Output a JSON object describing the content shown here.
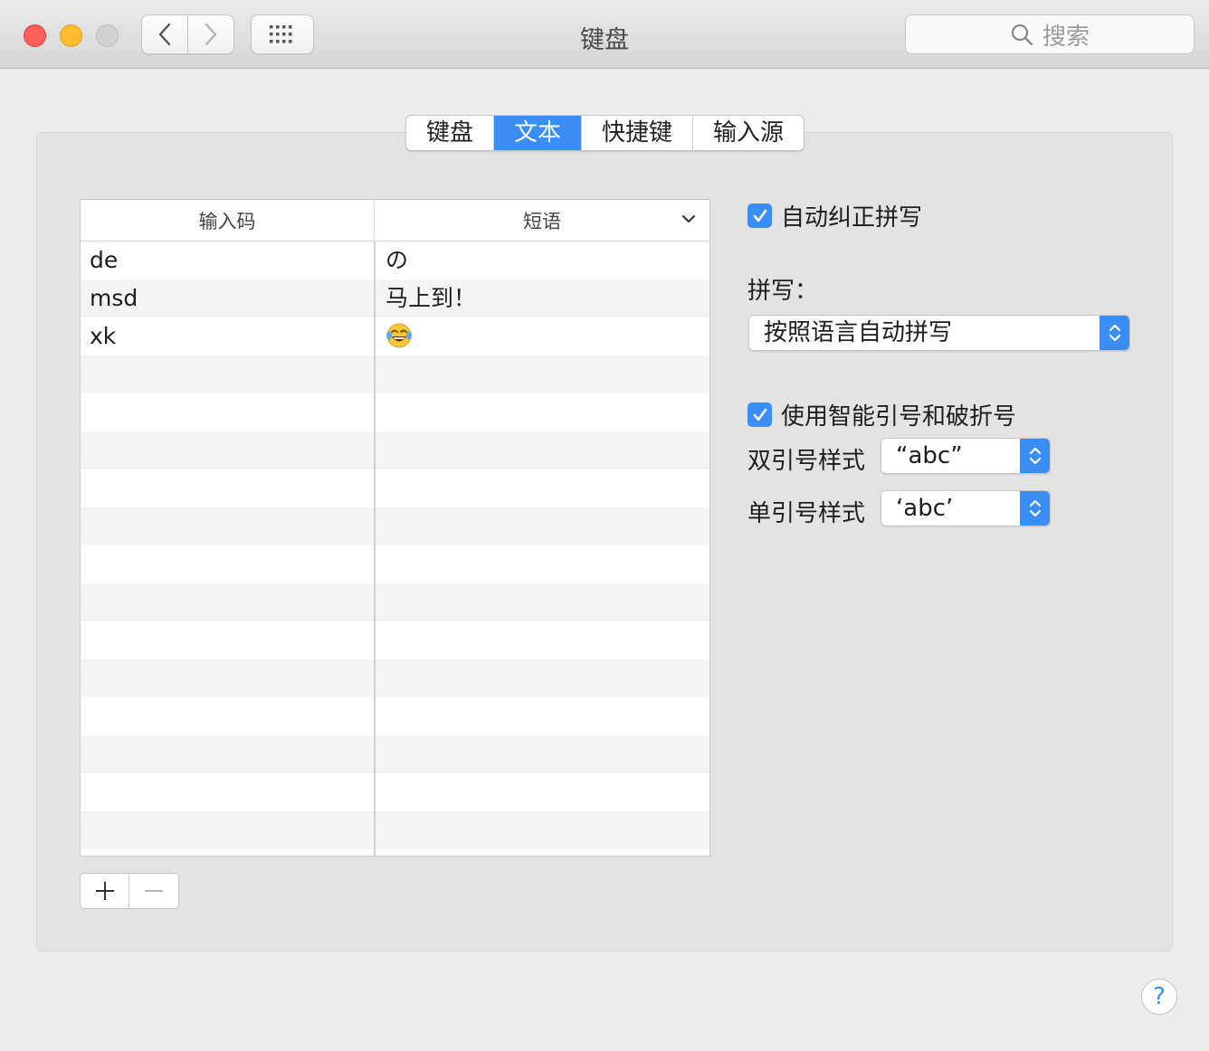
{
  "window": {
    "title": "键盘"
  },
  "toolbar": {
    "search_placeholder": "搜索"
  },
  "tabs": [
    {
      "label": "键盘"
    },
    {
      "label": "文本",
      "active": true
    },
    {
      "label": "快捷键"
    },
    {
      "label": "输入源"
    }
  ],
  "table": {
    "headers": {
      "code": "输入码",
      "phrase": "短语"
    },
    "rows": [
      {
        "code": "de",
        "phrase": "の"
      },
      {
        "code": "msd",
        "phrase": "马上到！"
      },
      {
        "code": "xk",
        "phrase": "😂"
      }
    ]
  },
  "options": {
    "auto_correct": {
      "label": "自动纠正拼写",
      "checked": true
    },
    "spelling": {
      "label": "拼写：",
      "value": "按照语言自动拼写"
    },
    "smart_quotes": {
      "label": "使用智能引号和破折号",
      "checked": true
    },
    "double_quote": {
      "label": "双引号样式",
      "value": "“abc”"
    },
    "single_quote": {
      "label": "单引号样式",
      "value": "‘abc’"
    }
  },
  "help": {
    "label": "?"
  },
  "colors": {
    "accent": "#3a8df5"
  }
}
